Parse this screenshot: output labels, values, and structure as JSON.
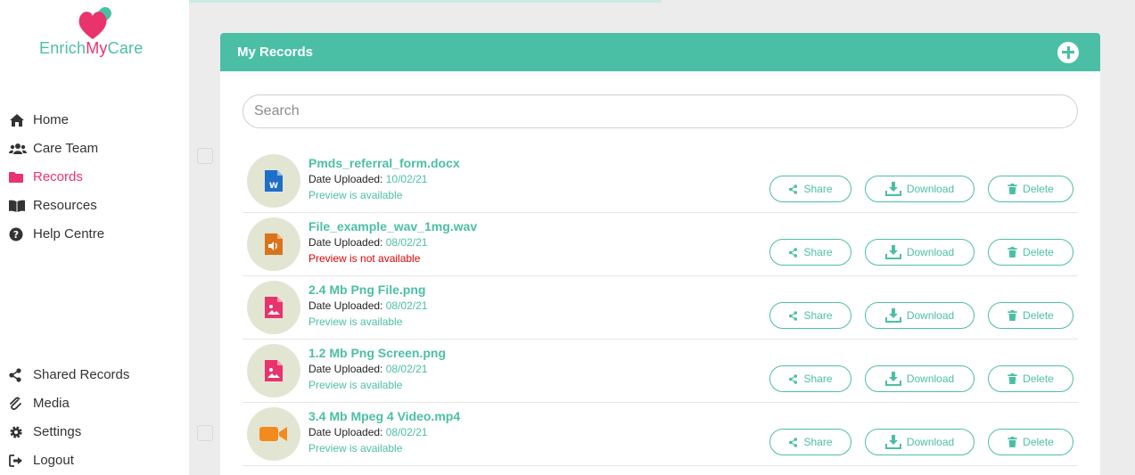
{
  "brand": {
    "part1": "Enrich",
    "part2": "My",
    "part3": "Care"
  },
  "nav": {
    "main": [
      {
        "label": "Home",
        "icon": "home-icon"
      },
      {
        "label": "Care Team",
        "icon": "users-icon"
      },
      {
        "label": "Records",
        "icon": "folder-icon",
        "active": true
      },
      {
        "label": "Resources",
        "icon": "book-icon"
      },
      {
        "label": "Help Centre",
        "icon": "question-icon"
      }
    ],
    "bottom": [
      {
        "label": "Shared Records",
        "icon": "share-icon"
      },
      {
        "label": "Media",
        "icon": "paperclip-icon"
      },
      {
        "label": "Settings",
        "icon": "gear-icon"
      },
      {
        "label": "Logout",
        "icon": "logout-icon"
      }
    ]
  },
  "panel": {
    "title": "My Records"
  },
  "search": {
    "placeholder": "Search"
  },
  "labels": {
    "date_uploaded": "Date Uploaded:",
    "share": "Share",
    "download": "Download",
    "delete": "Delete"
  },
  "records": [
    {
      "name": "Pmds_referral_form.docx",
      "date": "10/02/21",
      "preview": "Preview is available",
      "preview_ok": true,
      "type": "word"
    },
    {
      "name": "File_example_wav_1mg.wav",
      "date": "08/02/21",
      "preview": "Preview is not available",
      "preview_ok": false,
      "type": "audio"
    },
    {
      "name": "2.4 Mb Png File.png",
      "date": "08/02/21",
      "preview": "Preview is available",
      "preview_ok": true,
      "type": "image"
    },
    {
      "name": "1.2 Mb Png Screen.png",
      "date": "08/02/21",
      "preview": "Preview is available",
      "preview_ok": true,
      "type": "image"
    },
    {
      "name": "3.4 Mb Mpeg 4 Video.mp4",
      "date": "08/02/21",
      "preview": "Preview is available",
      "preview_ok": true,
      "type": "video"
    }
  ],
  "colors": {
    "accent": "#4bbfa5",
    "brand_pink": "#e8336d",
    "error": "#e00000"
  }
}
